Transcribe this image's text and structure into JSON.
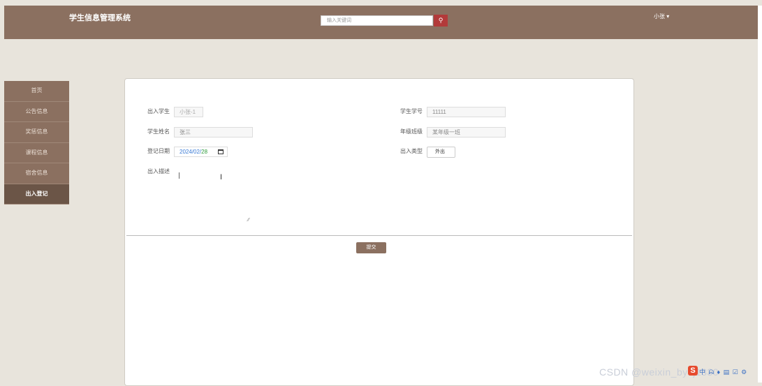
{
  "header": {
    "title": "学生信息管理系统",
    "search_placeholder": "输入关键词",
    "search_icon": "magnifier-icon",
    "user": "小张 ▾"
  },
  "sidebar": {
    "items": [
      {
        "label": "首页"
      },
      {
        "label": "公告信息"
      },
      {
        "label": "奖惩信息"
      },
      {
        "label": "课程信息"
      },
      {
        "label": "宿舍信息"
      },
      {
        "label": "出入登记",
        "active": true
      }
    ]
  },
  "form": {
    "student_label": "出入学生",
    "student_value": "小张-1",
    "student_no_label": "学生学号",
    "student_no_value": "11111",
    "name_label": "学生姓名",
    "name_value": "张三",
    "grade_label": "年级班级",
    "grade_value": "某年级一班",
    "date_label": "登记日期",
    "date_value": "2024/02/",
    "date_day": "28",
    "type_label": "出入类型",
    "type_value": "外出",
    "desc_label": "出入描述",
    "submit": "提交"
  },
  "overlay": {
    "watermark": "CSDN @weixin_bysj1330",
    "ime_logo": "S",
    "ime_tools": "中 ᗣ ♦ ▤ ☑ ⚙"
  }
}
